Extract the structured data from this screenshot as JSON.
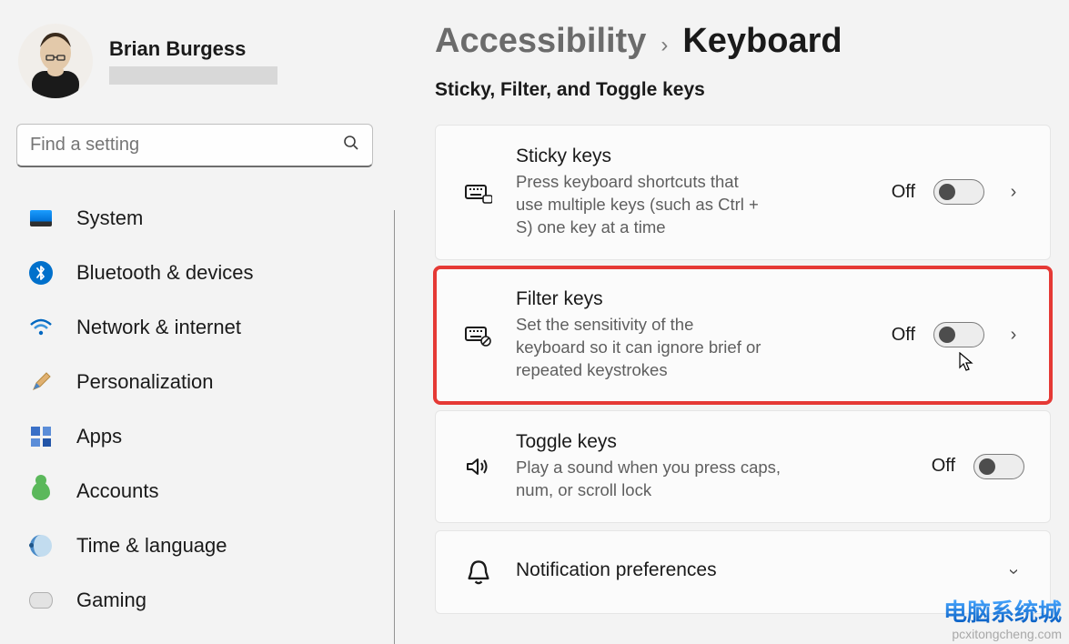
{
  "account": {
    "name": "Brian Burgess"
  },
  "search": {
    "placeholder": "Find a setting"
  },
  "nav": [
    {
      "key": "system",
      "label": "System"
    },
    {
      "key": "bluetooth",
      "label": "Bluetooth & devices"
    },
    {
      "key": "network",
      "label": "Network & internet"
    },
    {
      "key": "personalization",
      "label": "Personalization"
    },
    {
      "key": "apps",
      "label": "Apps"
    },
    {
      "key": "accounts",
      "label": "Accounts"
    },
    {
      "key": "time",
      "label": "Time & language"
    },
    {
      "key": "gaming",
      "label": "Gaming"
    }
  ],
  "breadcrumb": {
    "parent": "Accessibility",
    "sep": "›",
    "current": "Keyboard"
  },
  "section_title": "Sticky, Filter, and Toggle keys",
  "cards": {
    "sticky": {
      "title": "Sticky keys",
      "sub": "Press keyboard shortcuts that use multiple keys (such as Ctrl + S) one key at a time",
      "state": "Off"
    },
    "filter": {
      "title": "Filter keys",
      "sub": "Set the sensitivity of the keyboard so it can ignore brief or repeated keystrokes",
      "state": "Off"
    },
    "toggle": {
      "title": "Toggle keys",
      "sub": "Play a sound when you press caps, num, or scroll lock",
      "state": "Off"
    },
    "notif": {
      "title": "Notification preferences"
    }
  },
  "watermark": {
    "cn": "电脑系统城",
    "url": "pcxitongcheng.com"
  }
}
